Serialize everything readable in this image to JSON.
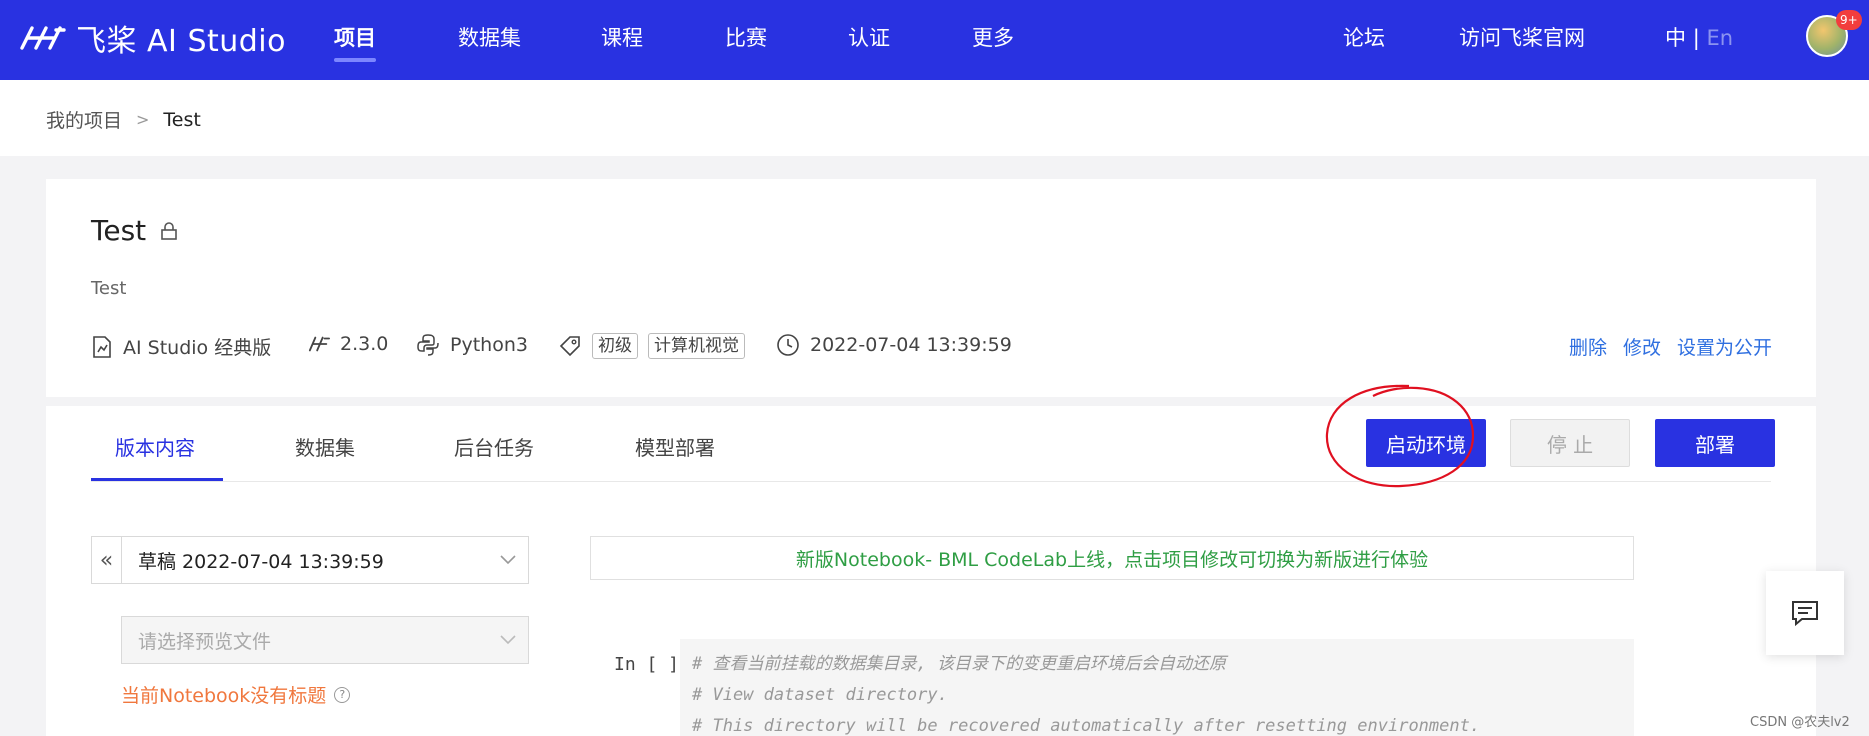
{
  "app": {
    "logo_text": "飞桨 AI Studio"
  },
  "nav": {
    "items": [
      "项目",
      "数据集",
      "课程",
      "比赛",
      "认证",
      "更多"
    ],
    "active_index": 0,
    "forum": "论坛",
    "official_site": "访问飞桨官网",
    "lang_zh": "中",
    "lang_sep": "|",
    "lang_en": "En",
    "notification_badge": "9+"
  },
  "breadcrumb": {
    "parent": "我的项目",
    "separator": ">",
    "current": "Test"
  },
  "project": {
    "title": "Test",
    "description": "Test",
    "edition": "AI Studio 经典版",
    "paddle_version": "2.3.0",
    "runtime": "Python3",
    "tags": [
      "初级",
      "计算机视觉"
    ],
    "updated_at": "2022-07-04 13:39:59",
    "actions": {
      "delete": "删除",
      "edit": "修改",
      "make_public": "设置为公开"
    }
  },
  "tabs": {
    "items": [
      "版本内容",
      "数据集",
      "后台任务",
      "模型部署"
    ],
    "active_index": 0
  },
  "buttons": {
    "start_env": "启动环境",
    "stop": "停 止",
    "deploy": "部署"
  },
  "version_select": {
    "collapse": "«",
    "value": "草稿 2022-07-04 13:39:59"
  },
  "file_select": {
    "placeholder": "请选择预览文件"
  },
  "notebook": {
    "no_title_warning": "当前Notebook没有标题",
    "help": "?",
    "notice": "新版Notebook- BML CodeLab上线，点击项目修改可切换为新版进行体验",
    "cell_prompt": "In [ ]",
    "code_lines": [
      "# 查看当前挂载的数据集目录, 该目录下的变更重启环境后会自动还原",
      "# View dataset directory.",
      "# This directory will be recovered automatically after resetting environment."
    ]
  },
  "watermark": "CSDN @农夫lv2",
  "colors": {
    "brand": "#2932e1",
    "link": "#2f6fe0",
    "warning": "#f0773d",
    "success": "#2f9e44",
    "annotation": "#e01020"
  },
  "icons": {
    "lock": "lock-icon",
    "edition": "document-chart-icon",
    "paddle": "paddle-logo-icon",
    "python": "python-icon",
    "tag": "tag-icon",
    "clock": "clock-icon",
    "chevron": "chevron-down-icon",
    "feedback": "message-icon"
  }
}
